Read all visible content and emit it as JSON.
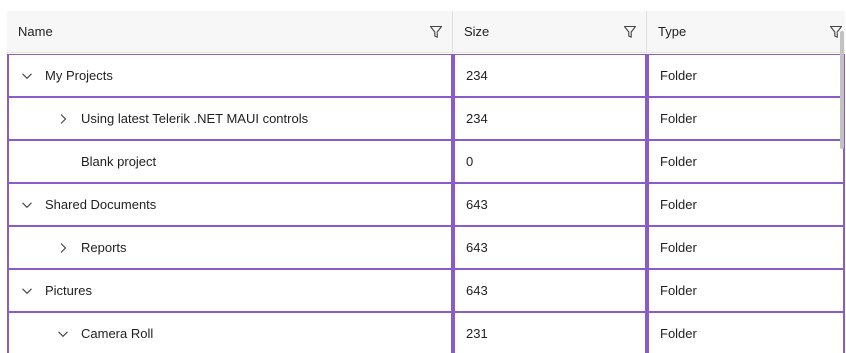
{
  "columns": [
    {
      "label": "Name"
    },
    {
      "label": "Size"
    },
    {
      "label": "Type"
    }
  ],
  "rows": [
    {
      "name": "My Projects",
      "size": "234",
      "type": "Folder",
      "level": 0,
      "expander": "expanded"
    },
    {
      "name": "Using latest Telerik .NET MAUI controls",
      "size": "234",
      "type": "Folder",
      "level": 1,
      "expander": "collapsed"
    },
    {
      "name": "Blank project",
      "size": "0",
      "type": "Folder",
      "level": 1,
      "expander": "none"
    },
    {
      "name": "Shared Documents",
      "size": "643",
      "type": "Folder",
      "level": 0,
      "expander": "expanded"
    },
    {
      "name": "Reports",
      "size": "643",
      "type": "Folder",
      "level": 1,
      "expander": "collapsed"
    },
    {
      "name": "Pictures",
      "size": "643",
      "type": "Folder",
      "level": 0,
      "expander": "expanded"
    },
    {
      "name": "Camera Roll",
      "size": "231",
      "type": "Folder",
      "level": 1,
      "expander": "expanded"
    }
  ],
  "icons": {
    "filter": "filter-icon",
    "expanded": "chevron-down-icon",
    "collapsed": "chevron-right-icon"
  },
  "colors": {
    "row_border": "#8a5cc9",
    "header_background": "#f7f7f7"
  }
}
